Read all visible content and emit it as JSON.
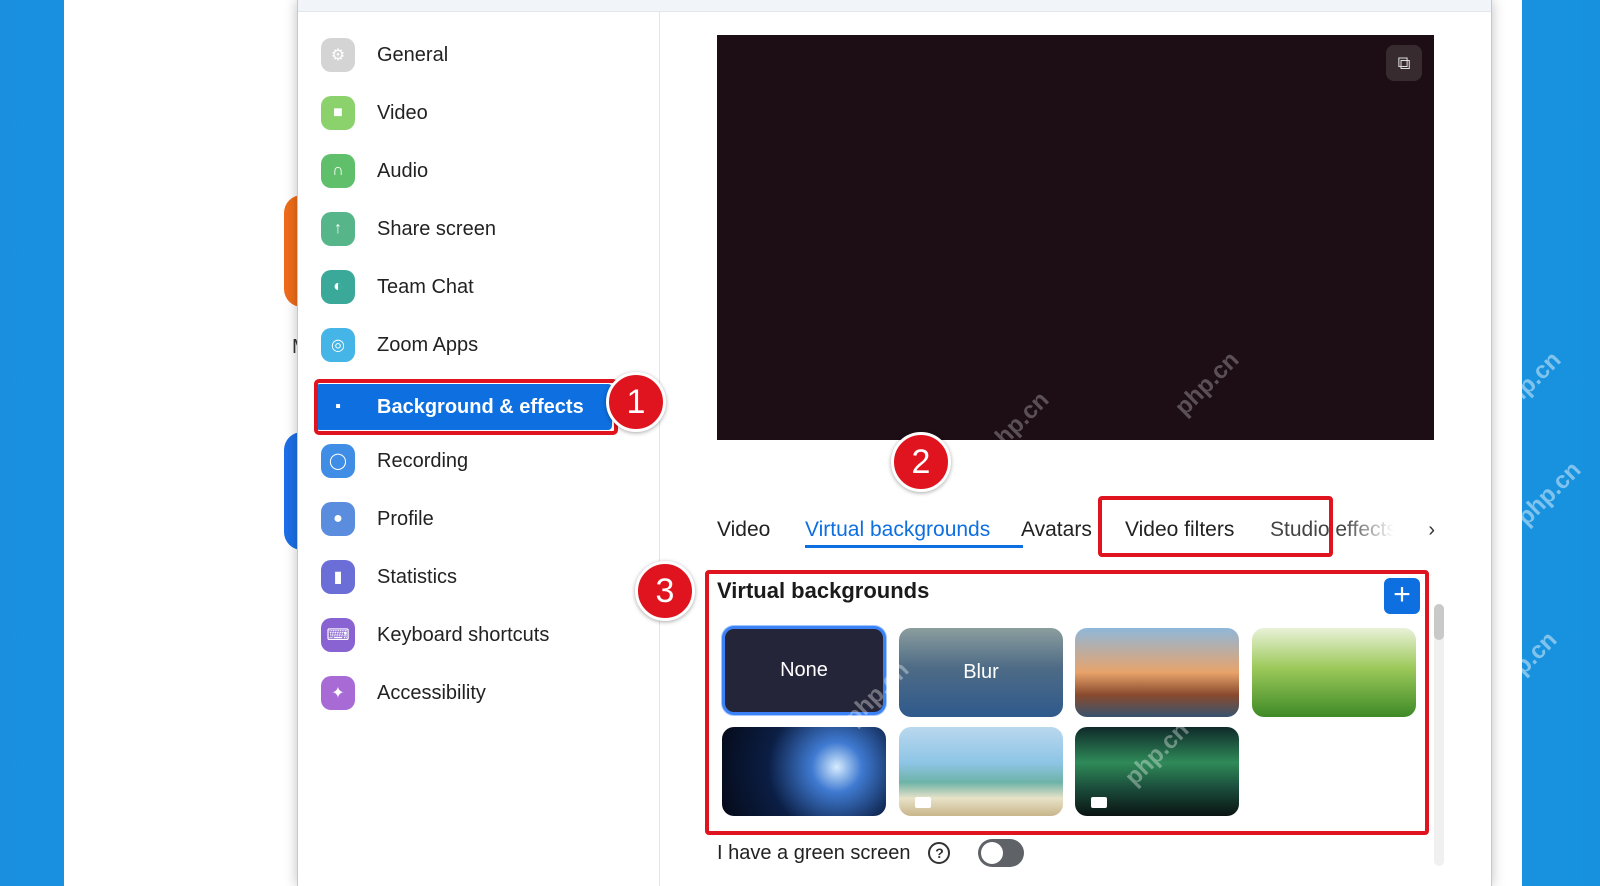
{
  "sidebar": {
    "items": [
      {
        "label": "General",
        "icon": "gear-icon",
        "color": "#d4d4d4",
        "glyph": "⚙"
      },
      {
        "label": "Video",
        "icon": "video-camera-icon",
        "color": "#8bd26c",
        "glyph": "■"
      },
      {
        "label": "Audio",
        "icon": "headphones-icon",
        "color": "#5fbf6a",
        "glyph": "∩"
      },
      {
        "label": "Share screen",
        "icon": "share-screen-icon",
        "color": "#57b58a",
        "glyph": "↑"
      },
      {
        "label": "Team Chat",
        "icon": "chat-icon",
        "color": "#3aa99a",
        "glyph": "◐"
      },
      {
        "label": "Zoom Apps",
        "icon": "apps-icon",
        "color": "#45b4e6",
        "glyph": "◎"
      },
      {
        "label": "Background & effects",
        "icon": "background-icon",
        "color": "#0e6fe0",
        "glyph": "▪"
      },
      {
        "label": "Recording",
        "icon": "record-icon",
        "color": "#3f8de4",
        "glyph": "◯"
      },
      {
        "label": "Profile",
        "icon": "profile-icon",
        "color": "#5b8dde",
        "glyph": "●"
      },
      {
        "label": "Statistics",
        "icon": "statistics-icon",
        "color": "#6a6ed6",
        "glyph": "▮"
      },
      {
        "label": "Keyboard shortcuts",
        "icon": "keyboard-icon",
        "color": "#8a63d2",
        "glyph": "⌨"
      },
      {
        "label": "Accessibility",
        "icon": "accessibility-icon",
        "color": "#a86bd6",
        "glyph": "✦"
      }
    ],
    "active_index": 6
  },
  "callouts": {
    "one": "1",
    "two": "2",
    "three": "3"
  },
  "tabs": {
    "items": [
      "Video",
      "Virtual backgrounds",
      "Avatars",
      "Video filters",
      "Studio effects"
    ],
    "active": "Virtual backgrounds"
  },
  "virtual_backgrounds": {
    "title": "Virtual backgrounds",
    "options": [
      {
        "label": "None",
        "selected": true
      },
      {
        "label": "Blur",
        "selected": false
      },
      {
        "label": "",
        "name": "golden-gate-bridge"
      },
      {
        "label": "",
        "name": "grass"
      },
      {
        "label": "",
        "name": "earth-from-space"
      },
      {
        "label": "",
        "name": "beach-palm"
      },
      {
        "label": "",
        "name": "aurora"
      }
    ]
  },
  "green_screen": {
    "label": "I have a green screen",
    "help": "?",
    "enabled": false
  },
  "watermark": "php.cn",
  "colors": {
    "accent": "#0e6fe0",
    "highlight": "#e0141f"
  }
}
